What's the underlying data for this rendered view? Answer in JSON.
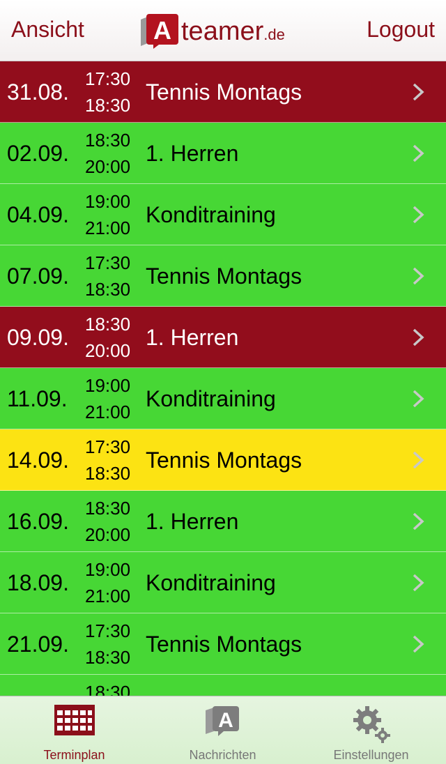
{
  "navbar": {
    "left_label": "Ansicht",
    "right_label": "Logout",
    "logo_letter": "A",
    "logo_word": "teamer",
    "logo_tld": ".de"
  },
  "colors": {
    "brand": "#8b0f1a",
    "declined": "#920d1c",
    "accepted": "#47d735",
    "maybe": "#fce313",
    "tab_inactive": "#777777"
  },
  "events": [
    {
      "date": "31.08.",
      "start": "17:30",
      "end": "18:30",
      "title": "Tennis Montags",
      "status": "declined"
    },
    {
      "date": "02.09.",
      "start": "18:30",
      "end": "20:00",
      "title": "1. Herren",
      "status": "accepted"
    },
    {
      "date": "04.09.",
      "start": "19:00",
      "end": "21:00",
      "title": "Konditraining",
      "status": "accepted"
    },
    {
      "date": "07.09.",
      "start": "17:30",
      "end": "18:30",
      "title": "Tennis Montags",
      "status": "accepted"
    },
    {
      "date": "09.09.",
      "start": "18:30",
      "end": "20:00",
      "title": "1. Herren",
      "status": "declined"
    },
    {
      "date": "11.09.",
      "start": "19:00",
      "end": "21:00",
      "title": "Konditraining",
      "status": "accepted"
    },
    {
      "date": "14.09.",
      "start": "17:30",
      "end": "18:30",
      "title": "Tennis Montags",
      "status": "maybe"
    },
    {
      "date": "16.09.",
      "start": "18:30",
      "end": "20:00",
      "title": "1. Herren",
      "status": "accepted"
    },
    {
      "date": "18.09.",
      "start": "19:00",
      "end": "21:00",
      "title": "Konditraining",
      "status": "accepted"
    },
    {
      "date": "21.09.",
      "start": "17:30",
      "end": "18:30",
      "title": "Tennis Montags",
      "status": "accepted"
    },
    {
      "date": "",
      "start": "18:30",
      "end": "",
      "title": "",
      "status": "accepted"
    }
  ],
  "tabs": [
    {
      "label": "Terminplan",
      "icon": "calendar-grid-icon",
      "active": true
    },
    {
      "label": "Nachrichten",
      "icon": "message-bubbles-icon",
      "active": false
    },
    {
      "label": "Einstellungen",
      "icon": "gears-icon",
      "active": false
    }
  ]
}
